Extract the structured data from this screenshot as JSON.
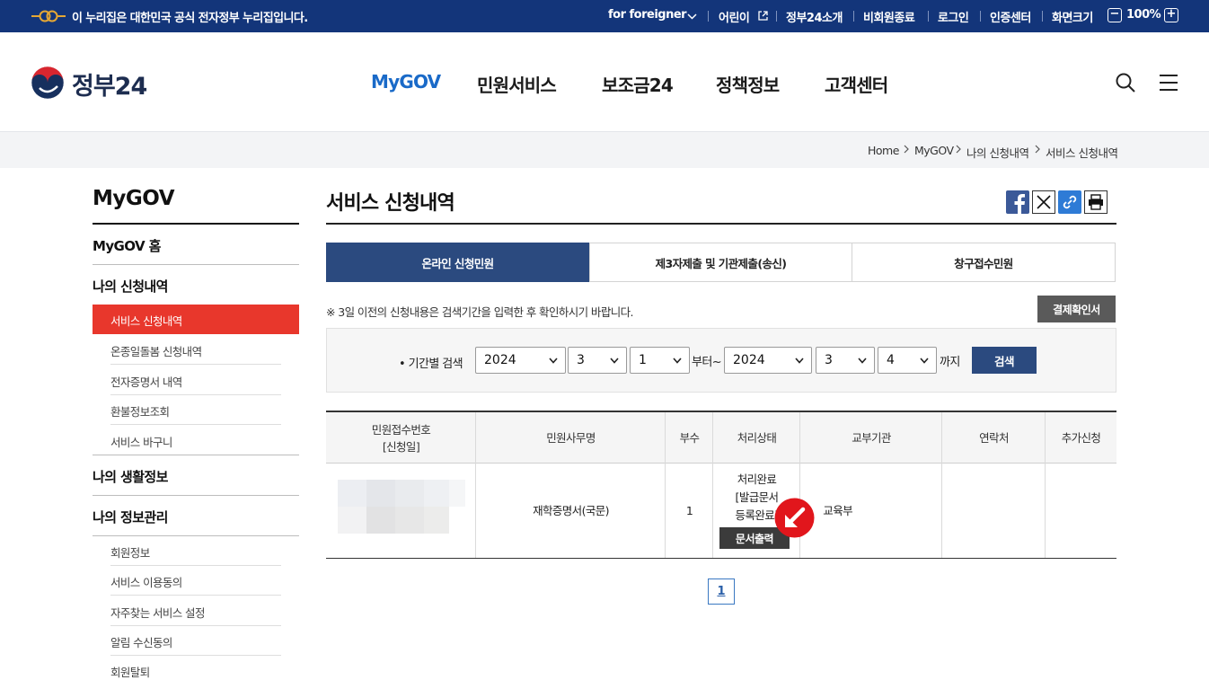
{
  "gov_strip": {
    "notice": "이 누리집은 대한민국 공식 전자정부 누리집입니다.",
    "links": [
      "for foreigner",
      "어린이",
      "정부24소개",
      "비회원종료",
      "로그인",
      "인증센터",
      "화면크기"
    ],
    "zoom": "100%"
  },
  "header": {
    "logo": "정부24",
    "nav": [
      "MyGOV",
      "민원서비스",
      "보조금24",
      "정책정보",
      "고객센터"
    ]
  },
  "breadcrumb": [
    "Home",
    "MyGOV",
    "나의 신청내역",
    "서비스 신청내역"
  ],
  "sidebar": {
    "title": "MyGOV",
    "home": "MyGOV 홈",
    "section1": "나의 신청내역",
    "section1_items": [
      "서비스 신청내역",
      "온종일돌봄 신청내역",
      "전자증명서 내역",
      "환불정보조회",
      "서비스 바구니"
    ],
    "section2": "나의 생활정보",
    "section3": "나의 정보관리",
    "section3_items": [
      "회원정보",
      "서비스 이용동의",
      "자주찾는 서비스 설정",
      "알림 수신동의",
      "회원탈퇴"
    ]
  },
  "main": {
    "title": "서비스 신청내역",
    "tabs": [
      "온라인 신청민원",
      "제3자제출 및 기관제출(송신)",
      "창구접수민원"
    ],
    "notice": "※ 3일 이전의 신청내용은 검색기간을 입력한 후 확인하시기 바랍니다.",
    "pay_button": "결제확인서"
  },
  "search": {
    "label": "기간별 검색",
    "from": {
      "year": "2024",
      "month": "3",
      "day": "1"
    },
    "from_suffix": "부터~",
    "to": {
      "year": "2024",
      "month": "3",
      "day": "4"
    },
    "to_suffix": "까지",
    "button": "검색"
  },
  "table": {
    "headers": [
      "민원접수번호\n[신청일]",
      "민원사무명",
      "부수",
      "처리상태",
      "교부기관",
      "연락처",
      "추가신청"
    ],
    "rows": [
      {
        "name": "재학증명서(국문)",
        "count": "1",
        "status_line1": "처리완료",
        "status_line2": "[발급문서",
        "status_line3": "등록완료]",
        "print_button": "문서출력",
        "agency": "교육부",
        "contact": "",
        "extra": ""
      }
    ]
  },
  "pagination": {
    "current": "1"
  }
}
